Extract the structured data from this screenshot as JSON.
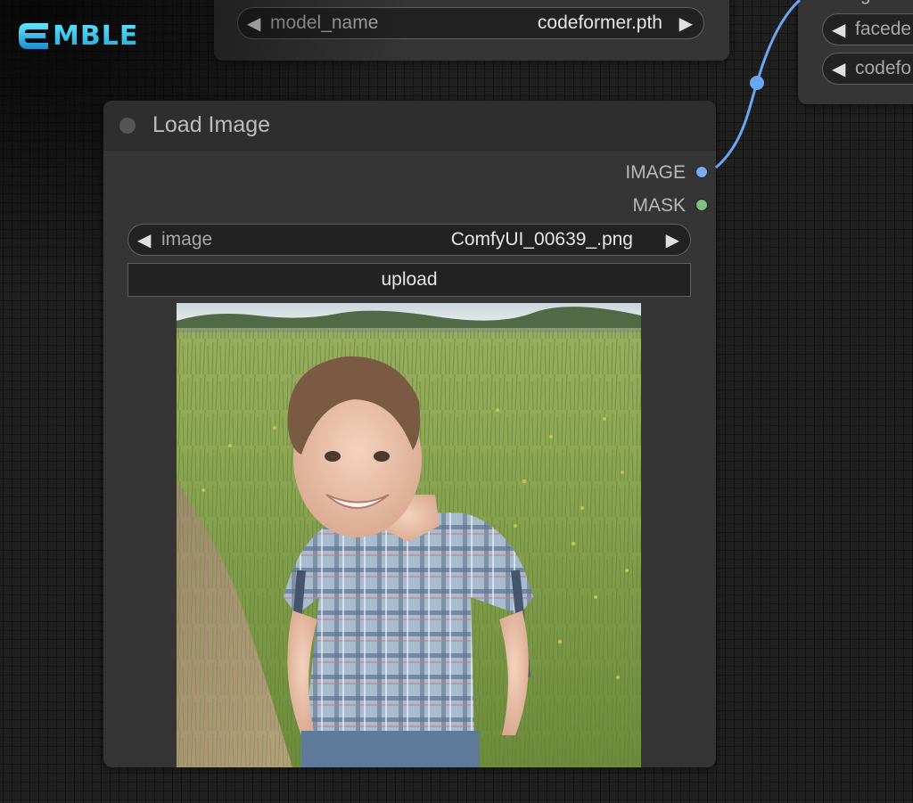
{
  "logo": {
    "text": "MBLE"
  },
  "top_node": {
    "widget": {
      "label": "model_name",
      "value": "codeformer.pth"
    }
  },
  "right_node": {
    "partial_label": "image",
    "widgets": [
      {
        "label": "facede"
      },
      {
        "label": "codefo"
      }
    ]
  },
  "load_image_node": {
    "title": "Load Image",
    "outputs": [
      {
        "label": "IMAGE",
        "color": "#7aaaf0"
      },
      {
        "label": "MASK",
        "color": "#80c080"
      }
    ],
    "image_widget": {
      "label": "image",
      "value": "ComfyUI_00639_.png"
    },
    "upload_label": "upload"
  },
  "colors": {
    "link": "#6aa6f2",
    "node_bg": "#353535",
    "canvas_bg": "#202020"
  }
}
